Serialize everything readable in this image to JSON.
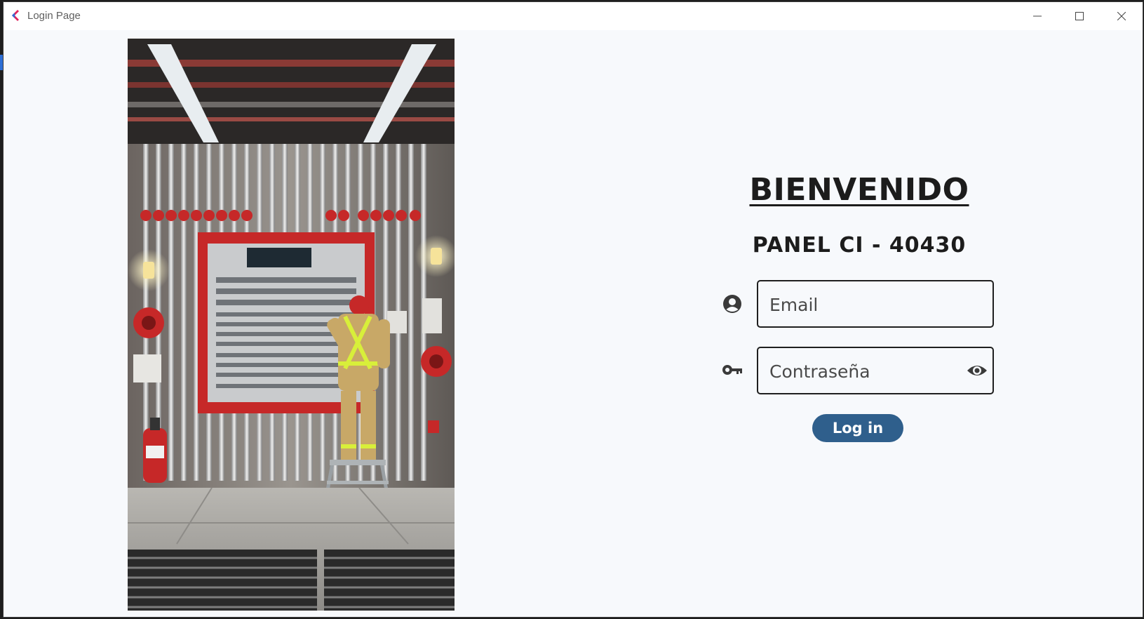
{
  "window": {
    "title": "Login Page",
    "controls": [
      "minimize",
      "maximize",
      "close"
    ]
  },
  "hero_image": {
    "icon": "fire-panel-technician-illustration"
  },
  "login": {
    "heading": "BIENVENIDO",
    "subheading": "PANEL CI - 40430",
    "email": {
      "placeholder": "Email",
      "value": "",
      "icon": "user-circle-icon"
    },
    "password": {
      "placeholder": "Contraseña",
      "value": "",
      "icon": "key-icon",
      "toggle_icon": "eye-icon"
    },
    "submit_label": "Log in"
  },
  "colors": {
    "background": "#f7f9fc",
    "button": "#2f5f8c",
    "text": "#1c1c1c",
    "field_border": "#1f1f1f"
  }
}
